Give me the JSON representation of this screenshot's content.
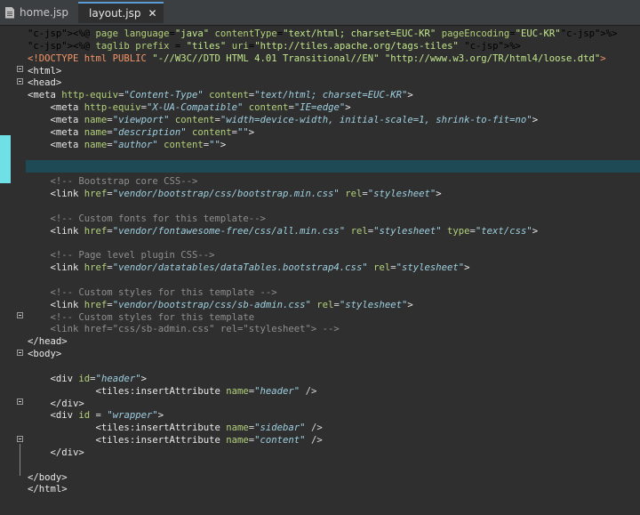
{
  "tabs": [
    {
      "label": "home.jsp",
      "active": false
    },
    {
      "label": "layout.jsp",
      "active": true
    }
  ],
  "code_lines": [
    "<%@ page language=\"java\" contentType=\"text/html; charset=EUC-KR\" pageEncoding=\"EUC-KR\"%>",
    "<%@ taglib prefix = \"tiles\" uri=\"http://tiles.apache.org/tags-tiles\" %>",
    "<!DOCTYPE html PUBLIC \"-//W3C//DTD HTML 4.01 Transitional//EN\" \"http://www.w3.org/TR/html4/loose.dtd\">",
    "<html>",
    "<head>",
    "<meta http-equiv=\"Content-Type\" content=\"text/html; charset=EUC-KR\">",
    "    <meta http-equiv=\"X-UA-Compatible\" content=\"IE=edge\">",
    "    <meta name=\"viewport\" content=\"width=device-width, initial-scale=1, shrink-to-fit=no\">",
    "    <meta name=\"description\" content=\"\">",
    "    <meta name=\"author\" content=\"\">",
    "",
    "",
    "    <!-- Bootstrap core CSS-->",
    "    <link href=\"vendor/bootstrap/css/bootstrap.min.css\" rel=\"stylesheet\">",
    "",
    "    <!-- Custom fonts for this template-->",
    "    <link href=\"vendor/fontawesome-free/css/all.min.css\" rel=\"stylesheet\" type=\"text/css\">",
    "",
    "    <!-- Page level plugin CSS-->",
    "    <link href=\"vendor/datatables/dataTables.bootstrap4.css\" rel=\"stylesheet\">",
    "",
    "    <!-- Custom styles for this template -->",
    "    <link href=\"vendor/bootstrap/css/sb-admin.css\" rel=\"stylesheet\">",
    "    <!-- Custom styles for this template",
    "    <link href=\"css/sb-admin.css\" rel=\"stylesheet\"> -->",
    "</head>",
    "<body>",
    "",
    "    <div id=\"header\">",
    "            <tiles:insertAttribute name=\"header\" />",
    "    </div>",
    "    <div id = \"wrapper\">",
    "            <tiles:insertAttribute name=\"sidebar\" />",
    "            <tiles:insertAttribute name=\"content\" />",
    "    </div>",
    "",
    "</body>",
    "</html>"
  ],
  "editor": {
    "current_line": 11
  },
  "colors": {
    "background": "#2f2f2f",
    "tag": "#e8e8e8",
    "attribute": "#b3d17a",
    "value": "#9ecfe0",
    "comment": "#8e8e8e",
    "jsp": "#f0c674",
    "current_line": "#1d4a55",
    "change_marker": "#6fe0e6"
  }
}
